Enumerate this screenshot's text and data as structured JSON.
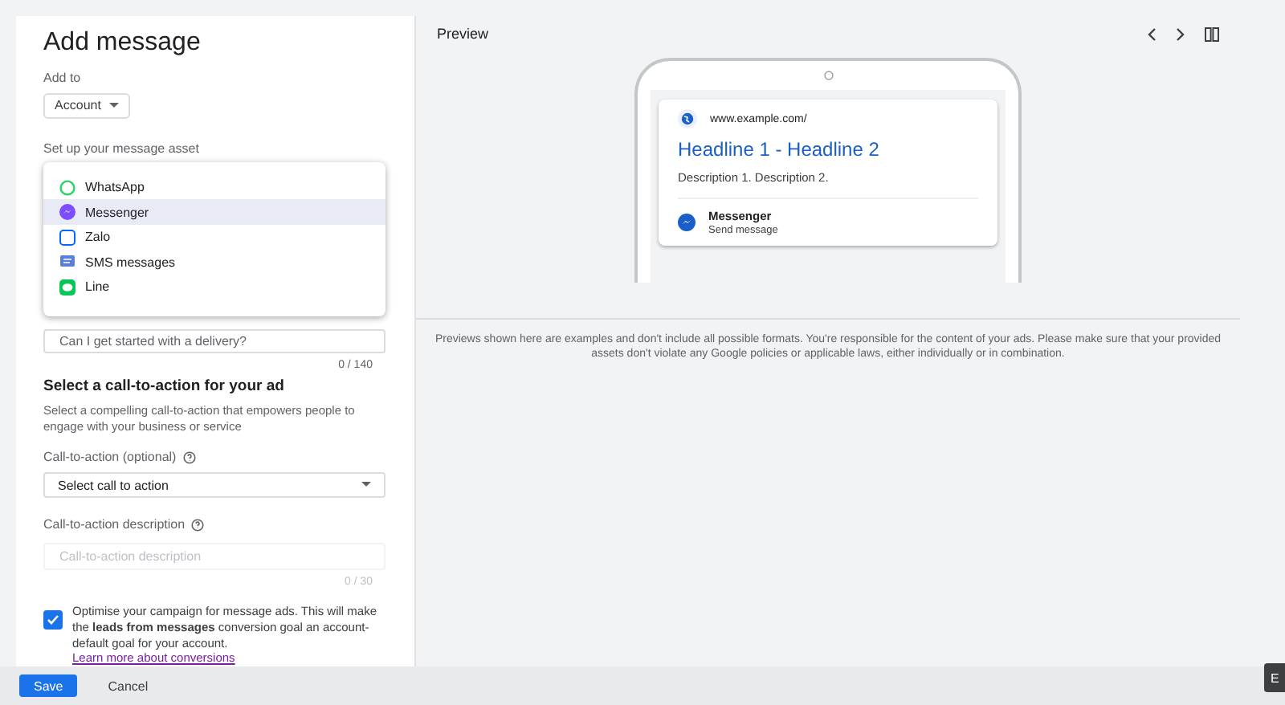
{
  "form": {
    "title": "Add message",
    "add_to": {
      "label": "Add to",
      "value": "Account"
    },
    "asset_label": "Set up your message asset",
    "asset_options": [
      {
        "label": "WhatsApp",
        "kind": "whatsapp",
        "selected": false
      },
      {
        "label": "Messenger",
        "kind": "messenger",
        "selected": true
      },
      {
        "label": "Zalo",
        "kind": "zalo",
        "selected": false
      },
      {
        "label": "SMS messages",
        "kind": "sms",
        "selected": false
      },
      {
        "label": "Line",
        "kind": "line",
        "selected": false
      }
    ],
    "starter": {
      "placeholder": "Can I get started with a delivery?",
      "counter": "0 / 140"
    },
    "cta_heading": "Select a call-to-action for your ad",
    "cta_description": "Select a compelling call-to-action that empowers people to engage with your business or service",
    "cta_label": "Call-to-action (optional)",
    "cta_select": "Select call to action",
    "cta_desc_label": "Call-to-action description",
    "cta_desc_field": {
      "placeholder": "Call-to-action description",
      "counter": "0 / 30"
    },
    "optimise": {
      "checked": true,
      "text": "Optimise your campaign for message ads. This will make the **leads from messages** conversion goal an account-default goal for your account.",
      "link": "Learn more about conversions"
    }
  },
  "preview": {
    "title": "Preview",
    "url": "www.example.com/",
    "headline": "Headline 1 - Headline 2",
    "description": "Description 1. Description 2.",
    "action_title": "Messenger",
    "action_subtitle": "Send message",
    "disclaimer": "Previews shown here are examples and don't include all possible formats. You're responsible for the content of your ads. Please make sure that your provided assets don't violate any Google policies or applicable laws, either individually or in combination."
  },
  "footer": {
    "buttons": [
      "Save",
      "Cancel"
    ]
  },
  "corner_tab": "E"
}
